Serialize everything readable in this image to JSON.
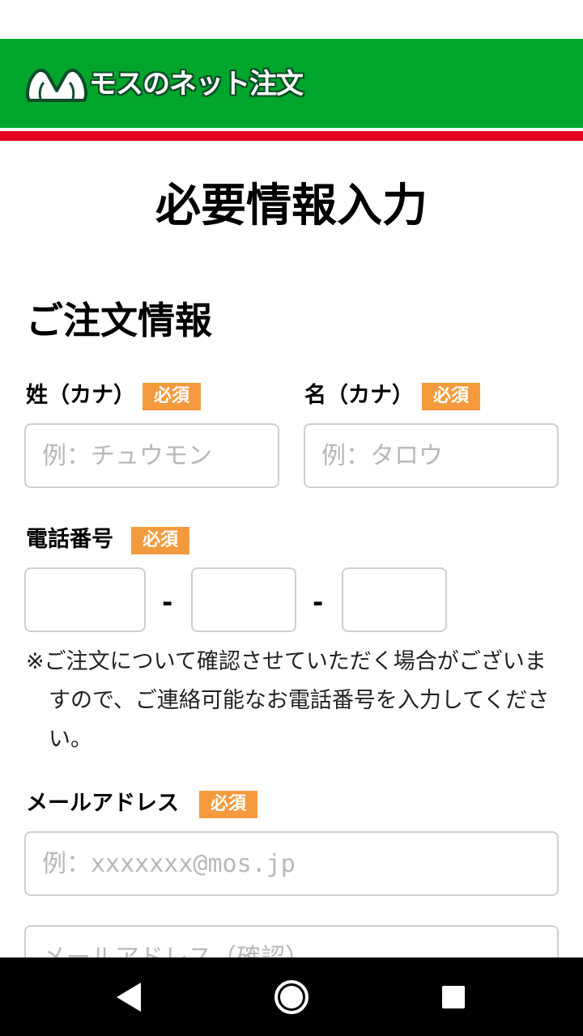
{
  "app": {
    "logo_text": "モスのネット注文",
    "logo_icon": "mos-burger-logo-icon"
  },
  "colors": {
    "brand_green": "#00a52b",
    "brand_red": "#e3001b",
    "required_badge": "#f39a3d"
  },
  "page": {
    "title": "必要情報入力"
  },
  "order_info": {
    "section_title": "ご注文情報",
    "required_label": "必須",
    "last_name": {
      "label": "姓（カナ）",
      "placeholder": "例：チュウモン",
      "value": ""
    },
    "first_name": {
      "label": "名（カナ）",
      "placeholder": "例：タロウ",
      "value": ""
    },
    "phone": {
      "label": "電話番号",
      "separator": "-",
      "part1": "",
      "part2": "",
      "part3": "",
      "note": "※ご注文について確認させていただく場合がございますので、ご連絡可能なお電話番号を入力してください。"
    },
    "email": {
      "label": "メールアドレス",
      "placeholder": "例：xxxxxxx@mos.jp",
      "confirm_placeholder": "メールアドレス（確認）",
      "value": ""
    }
  },
  "nav": {
    "back_icon": "back-triangle-icon",
    "home_icon": "home-circle-icon",
    "recents_icon": "recents-square-icon"
  }
}
